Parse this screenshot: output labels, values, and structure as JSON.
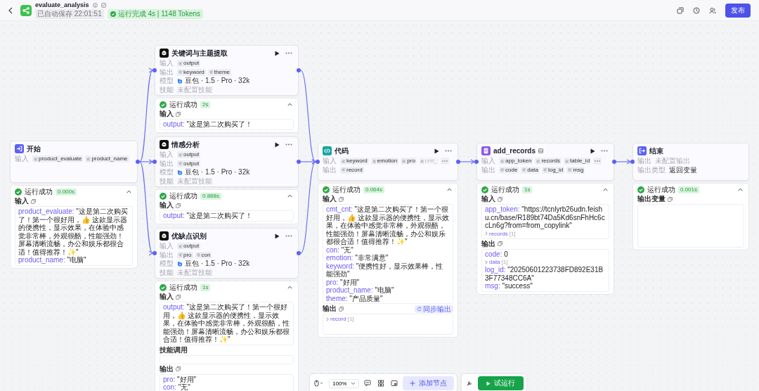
{
  "header": {
    "title": "evaluate_analysis",
    "saved": "已自动保存 22:01:51",
    "run_status": "运行完成 4s | 1148 Tokens",
    "publish": "发布"
  },
  "nodes": [
    {
      "kind": "start",
      "title": "开始",
      "rows": [
        {
          "kind": "tags",
          "label": "输入",
          "more": false,
          "tags": [
            {
              "name": "product_evaluate",
              "faded": false
            },
            {
              "name": "product_name",
              "faded": false
            }
          ]
        }
      ],
      "result": {
        "status": "运行成功",
        "time": "0.000s",
        "sections": [
          {
            "kind": "fields",
            "title": "输入",
            "copy": true,
            "items": [
              {
                "key": "product_evaluate:",
                "value": "\"这是第二次购买了！第一个很好用，👍 这款显示器的便携性，显示效果，在体验中感觉非常棒，外观很酷，性能强劲！屏幕清晰流畅，办公和娱乐都很合适！值得推荐！✨\""
              },
              {
                "key": "product_name:",
                "value": "\"电脑\""
              }
            ]
          }
        ]
      }
    },
    {
      "kind": "llm",
      "title": "关键词与主题提取",
      "rows": [
        {
          "kind": "tags",
          "label": "输入",
          "more": false,
          "tags": [
            {
              "name": "output",
              "faded": false
            }
          ]
        },
        {
          "kind": "tags",
          "label": "输出",
          "more": false,
          "tags": [
            {
              "name": "keyword",
              "faded": false
            },
            {
              "name": "theme",
              "faded": false
            }
          ]
        },
        {
          "kind": "model",
          "label": "模型",
          "text": "豆包 · 1.5 · Pro · 32k"
        },
        {
          "kind": "text",
          "label": "技能",
          "text": "未配置技能",
          "muted": true
        }
      ],
      "result": {
        "status": "运行成功",
        "time": "2s",
        "sections": [
          {
            "kind": "fields",
            "title": "输入",
            "copy": true,
            "items": [
              {
                "key": "output:",
                "value": "\"这是第二次购买了！"
              }
            ]
          }
        ]
      }
    },
    {
      "kind": "llm",
      "title": "情感分析",
      "rows": [
        {
          "kind": "tags",
          "label": "输入",
          "more": false,
          "tags": [
            {
              "name": "output",
              "faded": false
            }
          ]
        },
        {
          "kind": "tags",
          "label": "输出",
          "more": false,
          "tags": [
            {
              "name": "output",
              "faded": false
            }
          ]
        },
        {
          "kind": "model",
          "label": "模型",
          "text": "豆包 · 1.5 · Pro · 32k"
        },
        {
          "kind": "text",
          "label": "技能",
          "text": "未配置技能",
          "muted": true
        }
      ],
      "result": {
        "status": "运行成功",
        "time": "0.888s",
        "sections": [
          {
            "kind": "fields",
            "title": "输入",
            "copy": true,
            "items": [
              {
                "key": "output:",
                "value": "\"这是第二次购买了！"
              }
            ]
          }
        ]
      }
    },
    {
      "kind": "llm",
      "title": "优缺点识别",
      "rows": [
        {
          "kind": "tags",
          "label": "输入",
          "more": false,
          "tags": [
            {
              "name": "output",
              "faded": false
            }
          ]
        },
        {
          "kind": "tags",
          "label": "输出",
          "more": false,
          "tags": [
            {
              "name": "pro",
              "faded": false
            },
            {
              "name": "con",
              "faded": false
            }
          ]
        },
        {
          "kind": "model",
          "label": "模型",
          "text": "豆包 · 1.5 · Pro · 32k"
        },
        {
          "kind": "text",
          "label": "技能",
          "text": "未配置技能",
          "muted": true
        }
      ],
      "result": {
        "status": "运行成功",
        "time": "1s",
        "sections": [
          {
            "kind": "fields",
            "title": "输入",
            "copy": true,
            "items": [
              {
                "key": "output:",
                "value": "\"这是第二次购买了！第一个很好用，👍 这款显示器的便携性，显示效果，在体验中感觉非常棒，外观很酷，性能强劲！屏幕清晰流畅，办公和娱乐都很合适！值得推荐！✨\""
              }
            ]
          },
          {
            "kind": "empty",
            "title": "技能调用",
            "copy": false
          },
          {
            "kind": "fields",
            "title": "输出",
            "copy": true,
            "items": [
              {
                "key": "pro:",
                "value": "\"好用\""
              },
              {
                "key": "con:",
                "value": "\"无\""
              }
            ]
          }
        ]
      }
    },
    {
      "kind": "code",
      "title": "代码",
      "rows": [
        {
          "kind": "tags",
          "label": "输入",
          "more": true,
          "tags": [
            {
              "name": "keyword",
              "faded": false
            },
            {
              "name": "emotion",
              "faded": false
            },
            {
              "name": "pro",
              "faded": false
            },
            {
              "name": "cmt_",
              "faded": true
            }
          ]
        },
        {
          "kind": "tags",
          "label": "输出",
          "more": false,
          "tags": [
            {
              "name": "record",
              "faded": false
            }
          ]
        }
      ],
      "result": {
        "status": "运行成功",
        "time": "0.064s",
        "sections": [
          {
            "kind": "fields",
            "title": "输入",
            "copy": true,
            "items": [
              {
                "key": "cmt_cnt:",
                "value": "\"这是第二次购买了！第一个很好用，👍 这款显示器的便携性，显示效果，在体验中感觉非常棒，外观很酷，性能强劲！屏幕清晰流畅，办公和娱乐都很合适！值得推荐！✨\""
              },
              {
                "key": "con:",
                "value": "\"无\""
              },
              {
                "key": "emotion:",
                "value": "\"非常满意\""
              },
              {
                "key": "keyword:",
                "value": "\"便携性好，显示效果棒，性能强劲\""
              },
              {
                "key": "pro:",
                "value": "\"好用\""
              },
              {
                "key": "product_name:",
                "value": "\"电脑\""
              },
              {
                "key": "theme:",
                "value": "\"产品质量\""
              }
            ]
          },
          {
            "kind": "fields",
            "title": "输出",
            "copy": true,
            "badge": "同步输出",
            "items": [
              {
                "key": "record",
                "count": "[1]"
              }
            ]
          }
        ]
      }
    },
    {
      "kind": "plugin",
      "title": "add_records",
      "rows": [
        {
          "kind": "tags",
          "label": "输入",
          "more": true,
          "tags": [
            {
              "name": "app_token",
              "faded": false
            },
            {
              "name": "records",
              "faded": false
            },
            {
              "name": "table_id",
              "faded": false
            }
          ]
        },
        {
          "kind": "tags",
          "label": "输出",
          "more": false,
          "tags": [
            {
              "name": "code",
              "faded": false
            },
            {
              "name": "data",
              "faded": false
            },
            {
              "name": "log_id",
              "faded": false
            },
            {
              "name": "msg",
              "faded": false
            }
          ]
        }
      ],
      "result": {
        "status": "运行成功",
        "time": "1s",
        "sections": [
          {
            "kind": "fields",
            "title": "输入",
            "copy": true,
            "items": [
              {
                "key": "app_token:",
                "value": "\"https://tcnlyrb26udn.feishu.cn/base/R189bt74Da5Kd6snFhHc6ccLn6g?from=from_copylink\""
              },
              {
                "key": "records",
                "count": "[1]"
              }
            ]
          },
          {
            "kind": "fields",
            "title": "输出",
            "copy": true,
            "items": [
              {
                "key": "code:",
                "value": "0"
              },
              {
                "key": "data",
                "count": "[1]"
              },
              {
                "key": "log_id:",
                "value": "\"20250601223738FD892E31B3F77348CC6A\""
              },
              {
                "key": "msg:",
                "value": "\"success\""
              }
            ]
          }
        ]
      }
    },
    {
      "kind": "end",
      "title": "结束",
      "rows": [
        {
          "kind": "text",
          "label": "输出",
          "text": "未配置输出",
          "muted": true
        },
        {
          "kind": "text",
          "label": "输出类型",
          "text": "返回变量",
          "muted": false
        }
      ],
      "result": {
        "status": "运行成功",
        "time": "0.001s",
        "sections": [
          {
            "kind": "empty",
            "title": "输出变量",
            "copy": true
          }
        ]
      }
    }
  ],
  "toolbar": {
    "zoom": "100%",
    "add_node": "添加节点",
    "test_run": "试运行"
  }
}
